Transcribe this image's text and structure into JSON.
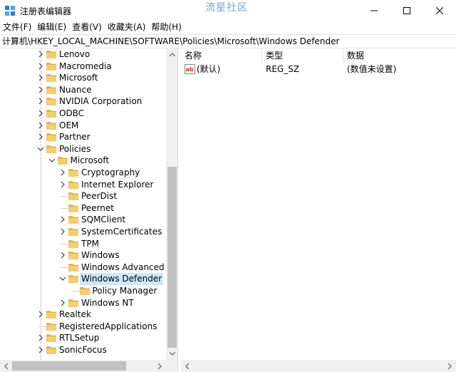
{
  "window": {
    "title": "注册表编辑器",
    "watermark": "流星社区"
  },
  "menu": [
    {
      "label": "文件(F)"
    },
    {
      "label": "编辑(E)"
    },
    {
      "label": "查看(V)"
    },
    {
      "label": "收藏夹(A)"
    },
    {
      "label": "帮助(H)"
    }
  ],
  "address": {
    "path": "计算机\\HKEY_LOCAL_MACHINE\\SOFTWARE\\Policies\\Microsoft\\Windows Defender"
  },
  "tree": {
    "items": [
      {
        "label": "Lenovo",
        "level": 0,
        "expander": "collapsed"
      },
      {
        "label": "Macromedia",
        "level": 0,
        "expander": "collapsed"
      },
      {
        "label": "Microsoft",
        "level": 0,
        "expander": "collapsed"
      },
      {
        "label": "Nuance",
        "level": 0,
        "expander": "collapsed"
      },
      {
        "label": "NVIDIA Corporation",
        "level": 0,
        "expander": "collapsed"
      },
      {
        "label": "ODBC",
        "level": 0,
        "expander": "collapsed"
      },
      {
        "label": "OEM",
        "level": 0,
        "expander": "collapsed"
      },
      {
        "label": "Partner",
        "level": 0,
        "expander": "collapsed"
      },
      {
        "label": "Policies",
        "level": 0,
        "expander": "expanded"
      },
      {
        "label": "Microsoft",
        "level": 1,
        "expander": "expanded"
      },
      {
        "label": "Cryptography",
        "level": 2,
        "expander": "collapsed"
      },
      {
        "label": "Internet Explorer",
        "level": 2,
        "expander": "collapsed"
      },
      {
        "label": "PeerDist",
        "level": 2,
        "expander": "none"
      },
      {
        "label": "Peernet",
        "level": 2,
        "expander": "none"
      },
      {
        "label": "SQMClient",
        "level": 2,
        "expander": "collapsed"
      },
      {
        "label": "SystemCertificates",
        "level": 2,
        "expander": "collapsed"
      },
      {
        "label": "TPM",
        "level": 2,
        "expander": "none"
      },
      {
        "label": "Windows",
        "level": 2,
        "expander": "collapsed"
      },
      {
        "label": "Windows Advanced T",
        "level": 2,
        "expander": "none"
      },
      {
        "label": "Windows Defender",
        "level": 2,
        "expander": "expanded",
        "selected": true
      },
      {
        "label": "Policy Manager",
        "level": 3,
        "expander": "none"
      },
      {
        "label": "Windows NT",
        "level": 2,
        "expander": "collapsed"
      },
      {
        "label": "Realtek",
        "level": 0,
        "expander": "collapsed"
      },
      {
        "label": "RegisteredApplications",
        "level": 0,
        "expander": "none"
      },
      {
        "label": "RTLSetup",
        "level": 0,
        "expander": "collapsed"
      },
      {
        "label": "SonicFocus",
        "level": 0,
        "expander": "collapsed"
      }
    ]
  },
  "list": {
    "columns": [
      {
        "label": "名称"
      },
      {
        "label": "类型"
      },
      {
        "label": "数据"
      }
    ],
    "rows": [
      {
        "name": "(默认)",
        "type": "REG_SZ",
        "data": "(数值未设置)",
        "icon": "ab-string-icon"
      }
    ]
  },
  "colors": {
    "selection": "#cce8ff",
    "folder": "#e8b33c"
  }
}
